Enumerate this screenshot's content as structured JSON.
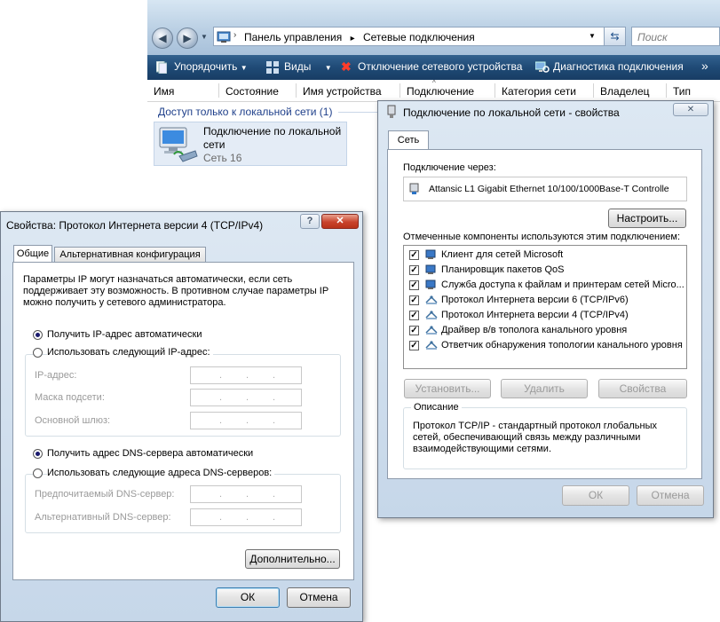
{
  "explorer": {
    "breadcrumb": [
      "Панель управления",
      "Сетевые подключения"
    ],
    "search_placeholder": "Поиск",
    "toolbar": {
      "organize": "Упорядочить",
      "views": "Виды",
      "disable": "Отключение сетевого устройства",
      "diagnose": "Диагностика подключения",
      "more": "»"
    },
    "columns": [
      "Имя",
      "Состояние",
      "Имя устройства",
      "Подключение",
      "Категория сети",
      "Владелец",
      "Тип"
    ],
    "group_header": "Доступ только к локальной сети (1)",
    "connection": {
      "name": "Подключение по локальной сети",
      "status": "Сеть  16"
    }
  },
  "props": {
    "title": "Подключение по локальной сети - свойства",
    "tab": "Сеть",
    "connect_via_label": "Подключение через:",
    "adapter": "Attansic L1 Gigabit Ethernet 10/100/1000Base-T Controlle",
    "configure_button": "Настроить...",
    "components_label": "Отмеченные компоненты используются этим подключением:",
    "components": [
      {
        "label": "Клиент для сетей Microsoft",
        "checked": true
      },
      {
        "label": "Планировщик пакетов QoS",
        "checked": true
      },
      {
        "label": "Служба доступа к файлам и принтерам сетей Micro...",
        "checked": true
      },
      {
        "label": "Протокол Интернета версии 6 (TCP/IPv6)",
        "checked": true
      },
      {
        "label": "Протокол Интернета версии 4 (TCP/IPv4)",
        "checked": true
      },
      {
        "label": "Драйвер в/в тополога канального уровня",
        "checked": true
      },
      {
        "label": "Ответчик обнаружения топологии канального уровня",
        "checked": true
      }
    ],
    "install_button": "Установить...",
    "remove_button": "Удалить",
    "properties_button": "Свойства",
    "description_title": "Описание",
    "description": "Протокол TCP/IP - стандартный протокол глобальных сетей, обеспечивающий связь между различными взаимодействующими сетями.",
    "ok_button": "ОК",
    "cancel_button": "Отмена",
    "close_glyph": "✕"
  },
  "ipv4": {
    "title": "Свойства: Протокол Интернета версии 4 (TCP/IPv4)",
    "help_glyph": "?",
    "close_glyph": "✕",
    "tabs": [
      "Общие",
      "Альтернативная конфигурация"
    ],
    "intro": "Параметры IP могут назначаться автоматически, если сеть поддерживает эту возможность. В противном случае параметры IP можно получить у сетевого администратора.",
    "auto_ip": "Получить IP-адрес автоматически",
    "manual_ip": "Использовать следующий IP-адрес:",
    "ip_label": "IP-адрес:",
    "mask_label": "Маска подсети:",
    "gateway_label": "Основной шлюз:",
    "auto_dns": "Получить адрес DNS-сервера автоматически",
    "manual_dns": "Использовать следующие адреса DNS-серверов:",
    "pref_dns_label": "Предпочитаемый DNS-сервер:",
    "alt_dns_label": "Альтернативный DNS-сервер:",
    "ip_placeholder_dots": ".",
    "advanced_button": "Дополнительно...",
    "ok_button": "ОК",
    "cancel_button": "Отмена"
  }
}
